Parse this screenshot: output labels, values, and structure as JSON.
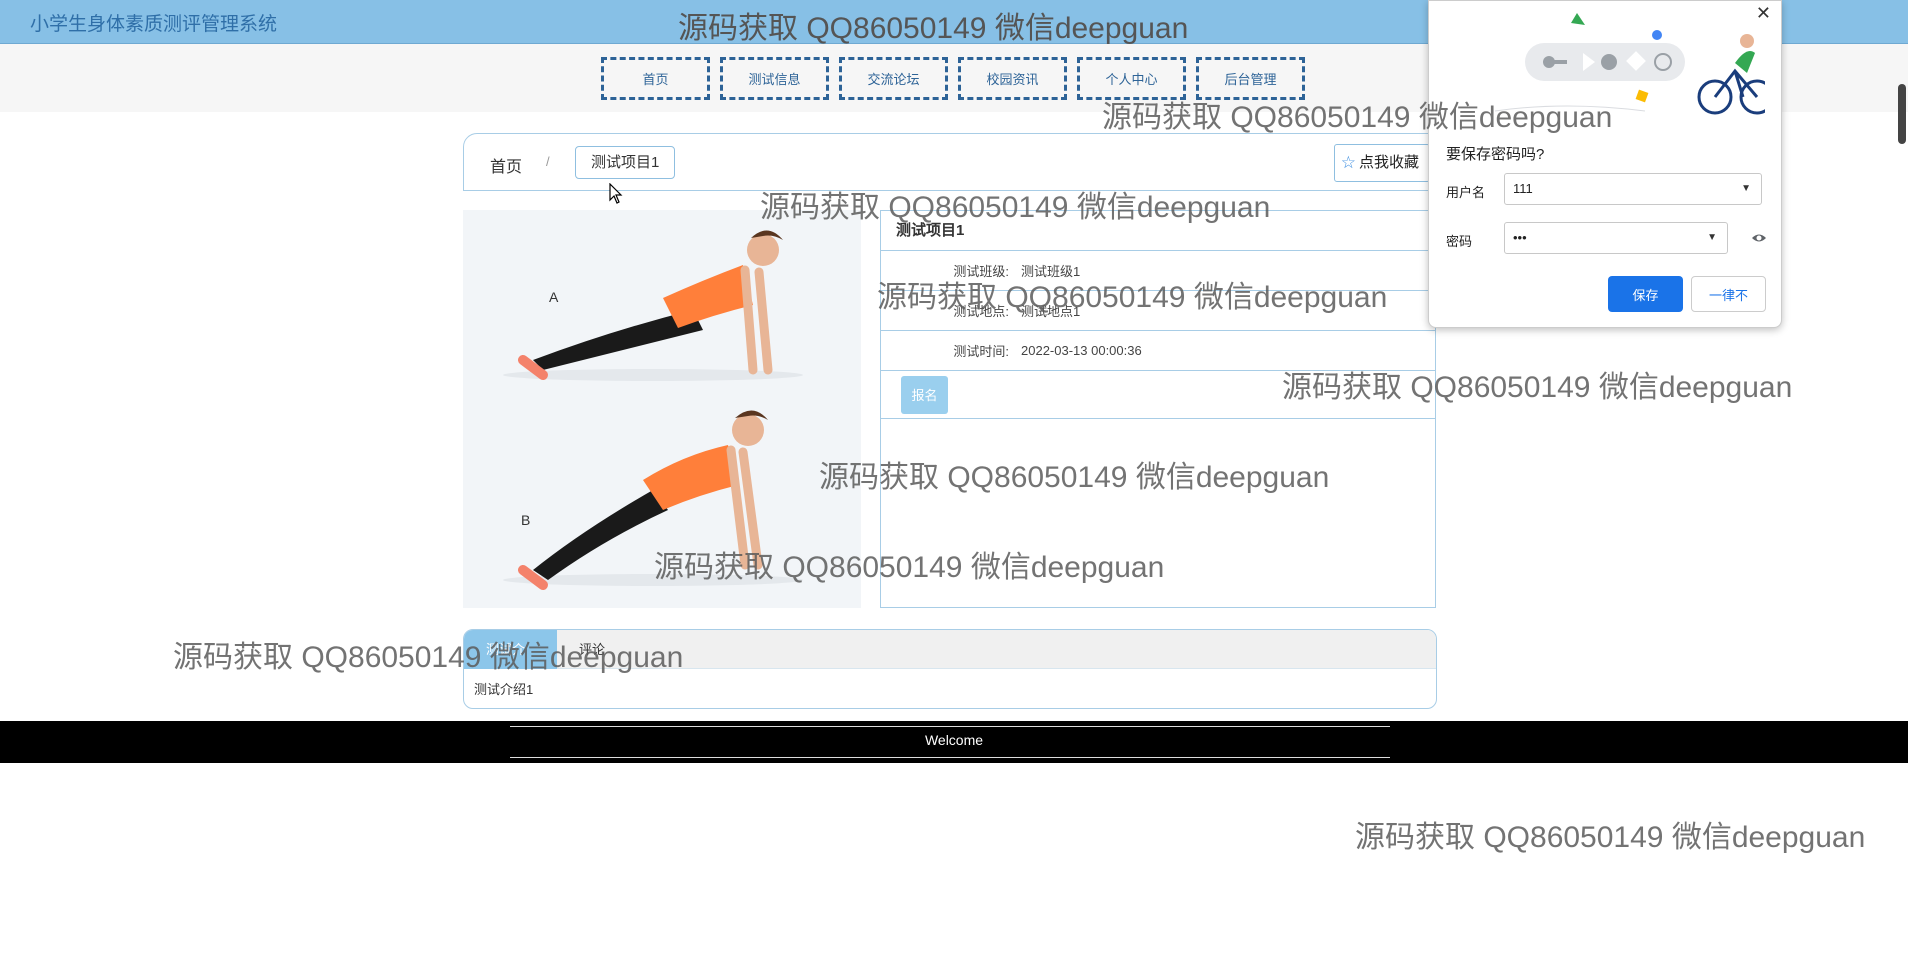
{
  "header": {
    "system_title": "小学生身体素质测评管理系统"
  },
  "nav": {
    "items": [
      "首页",
      "测试信息",
      "交流论坛",
      "校园资讯",
      "个人中心",
      "后台管理"
    ]
  },
  "breadcrumb": {
    "home": "首页",
    "separator": "/",
    "current": "测试项目1"
  },
  "favorite": {
    "icon": "star-icon",
    "label": "点我收藏"
  },
  "photo": {
    "label_a": "A",
    "label_b": "B"
  },
  "detail": {
    "title": "测试项目1",
    "rows": [
      {
        "label": "测试班级:",
        "value": "测试班级1"
      },
      {
        "label": "测试地点:",
        "value": "测试地点1"
      },
      {
        "label": "测试时间:",
        "value": "2022-03-13 00:00:36"
      }
    ],
    "signup_label": "报名"
  },
  "tabs": {
    "items": [
      "测试介绍",
      "评论"
    ],
    "active_index": 0,
    "content": "测试介绍1"
  },
  "footer": {
    "text": "Welcome"
  },
  "password_popup": {
    "title": "要保存密码吗?",
    "username_label": "用户名",
    "username_value": "111",
    "password_label": "密码",
    "password_value": "•••",
    "save_label": "保存",
    "never_label": "一律不",
    "close_icon": "close-icon",
    "eye_icon": "eye-icon"
  },
  "watermark": "源码获取 QQ86050149 微信deepguan",
  "colors": {
    "header_bg": "#87c0e6",
    "nav_border": "#2d6397",
    "panel_border": "#a8cde6",
    "primary_button": "#1a73e8",
    "signup_button": "#9acfee",
    "footer_bg": "#000000"
  }
}
